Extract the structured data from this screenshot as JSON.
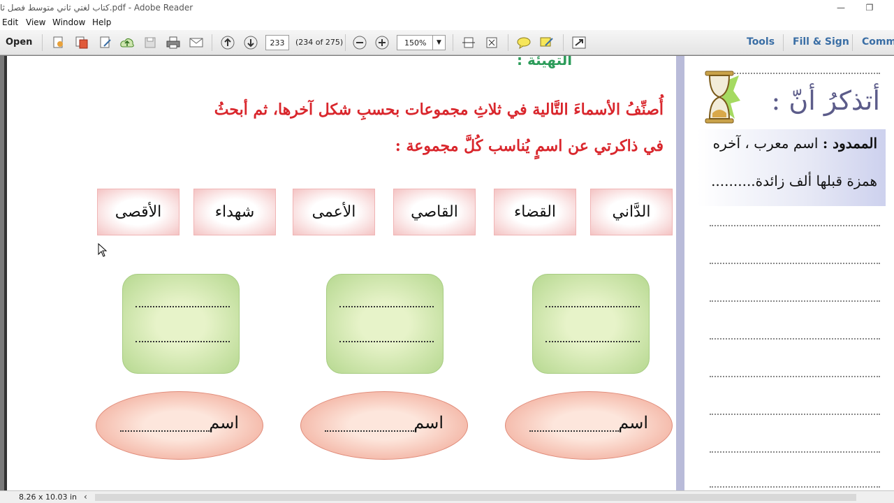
{
  "window": {
    "title": "كتاب لغتي ثاني متوسط فصل ثا.pdf - Adobe Reader",
    "minimize": "—",
    "restore": "❐"
  },
  "menu": [
    "Edit",
    "View",
    "Window",
    "Help"
  ],
  "toolbar": {
    "open_label": "Open",
    "page_number": "233",
    "page_info": "(234 of 275)",
    "zoom": "150%",
    "tools_label": "Tools",
    "fill_sign_label": "Fill & Sign",
    "comment_label": "Comm"
  },
  "document": {
    "section_title": "التهيئة :",
    "instruction_line1": "أُصنِّفُ الأسماءَ التَّالية في ثلاثِ مجموعات بحسبِ شكل آخرها، ثم أبحثُ",
    "instruction_line2": "في ذاكرتي عن اسمٍ يُناسب كُلَّ مجموعة :",
    "words": [
      "الدَّاني",
      "القضاء",
      "القاصي",
      "الأعمى",
      "شهداء",
      "الأقصى"
    ],
    "oval_label": "اسم",
    "remember_title": "أتذكرُ أنّ :",
    "definition_term": "الممدود :",
    "definition_line1": "اسم معرب ، آخره",
    "definition_line2": "همزة قبلها ألف زائدة.........."
  },
  "status": {
    "page_size": "8.26 x 10.03 in"
  }
}
